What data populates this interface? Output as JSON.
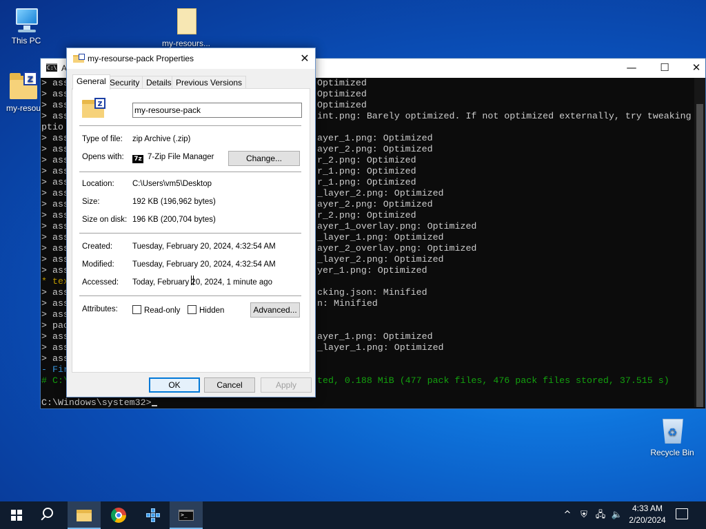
{
  "desktop": {
    "icons": [
      {
        "label": "This PC",
        "icon": "computer-icon"
      },
      {
        "label": "my-resours...",
        "icon": "document-icon"
      },
      {
        "label": "my-resou",
        "icon": "zip-folder-icon"
      },
      {
        "label": "Recycle Bin",
        "icon": "recycle-bin-icon"
      }
    ]
  },
  "console": {
    "title": "A",
    "lines": [
      {
        "left": "> ass",
        "right": "Optimized"
      },
      {
        "left": "> ass",
        "right": "Optimized"
      },
      {
        "left": "> ass",
        "right": "Optimized"
      },
      {
        "left": "> ass",
        "right": "int.png: Barely optimized. If not optimized externally, try tweaking o"
      },
      {
        "left": "ptio",
        "right": ""
      },
      {
        "left": "> ass",
        "right": "ayer_1.png: Optimized"
      },
      {
        "left": "> ass",
        "right": "ayer_2.png: Optimized"
      },
      {
        "left": "> ass",
        "right": "r_2.png: Optimized"
      },
      {
        "left": "> ass",
        "right": "r_1.png: Optimized"
      },
      {
        "left": "> ass",
        "right": "r_1.png: Optimized"
      },
      {
        "left": "> ass",
        "right": "_layer_2.png: Optimized"
      },
      {
        "left": "> ass",
        "right": "ayer_2.png: Optimized"
      },
      {
        "left": "> ass",
        "right": "r_2.png: Optimized"
      },
      {
        "left": "> ass",
        "right": "ayer_1_overlay.png: Optimized"
      },
      {
        "left": "> ass",
        "right": "_layer_1.png: Optimized"
      },
      {
        "left": "> ass",
        "right": "ayer_2_overlay.png: Optimized"
      },
      {
        "left": "> ass",
        "right": "_layer_2.png: Optimized"
      },
      {
        "left": "> ass",
        "right": "yer_1.png: Optimized"
      },
      {
        "left": "* tex",
        "right": "",
        "color": "yellow"
      },
      {
        "left": "> ass",
        "right": "cking.json: Minified"
      },
      {
        "left": "> ass",
        "right": "n: Minified"
      },
      {
        "left": "> ass",
        "right": ""
      },
      {
        "left": "> pac",
        "right": ""
      },
      {
        "left": "> ass",
        "right": "ayer_1.png: Optimized"
      },
      {
        "left": "> ass",
        "right": "_layer_1.png: Optimized"
      },
      {
        "left": "> ass",
        "right": ""
      },
      {
        "left": "- Fir",
        "right": "",
        "color": "cyan"
      },
      {
        "left": "# C:\\",
        "right": "ted, 0.188 MiB (477 pack files, 476 pack files stored, 37.515 s)",
        "color": "green"
      },
      {
        "left": "",
        "right": ""
      },
      {
        "left": "C:\\Windows\\system32>",
        "right": "",
        "prompt": true
      }
    ],
    "controls": {
      "minimize": "—",
      "maximize": "☐",
      "close": "✕"
    }
  },
  "dialog": {
    "title": "my-resourse-pack Properties",
    "close": "✕",
    "tabs": [
      "General",
      "Security",
      "Details",
      "Previous Versions"
    ],
    "active_tab": "General",
    "filename": "my-resourse-pack",
    "type_of_file": {
      "label": "Type of file:",
      "value": "zip Archive (.zip)"
    },
    "opens_with": {
      "label": "Opens with:",
      "value": "7-Zip File Manager",
      "app_icon": "7z",
      "button": "Change..."
    },
    "location": {
      "label": "Location:",
      "value": "C:\\Users\\vm5\\Desktop"
    },
    "size": {
      "label": "Size:",
      "value": "192 KB (196,962 bytes)"
    },
    "size_on_disk": {
      "label": "Size on disk:",
      "value": "196 KB (200,704 bytes)"
    },
    "created": {
      "label": "Created:",
      "value": "Tuesday, February 20, 2024, 4:32:54 AM"
    },
    "modified": {
      "label": "Modified:",
      "value": "Tuesday, February 20, 2024, 4:32:54 AM"
    },
    "accessed": {
      "label": "Accessed:",
      "value": "Today, February 20, 2024, 1 minute ago"
    },
    "attributes": {
      "label": "Attributes:",
      "readonly": "Read-only",
      "readonly_checked": false,
      "hidden": "Hidden",
      "hidden_checked": false,
      "advanced": "Advanced..."
    },
    "buttons": {
      "ok": "OK",
      "cancel": "Cancel",
      "apply": "Apply"
    }
  },
  "taskbar": {
    "items": [
      "start-icon",
      "search-icon",
      "file-explorer-icon",
      "chrome-icon",
      "app-icon",
      "command-prompt-icon"
    ],
    "tray": {
      "chevron": "^",
      "time": "4:33 AM",
      "date": "2/20/2024"
    }
  }
}
